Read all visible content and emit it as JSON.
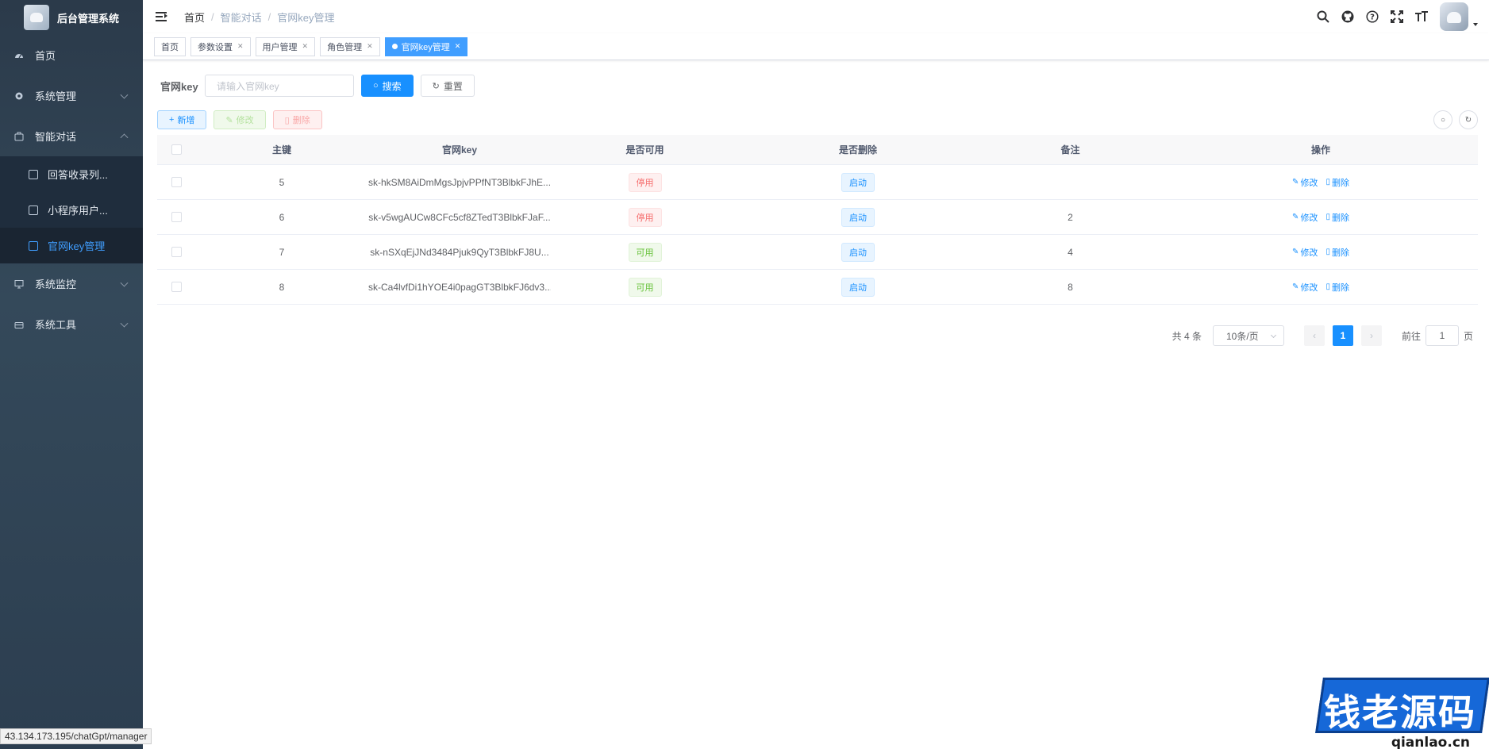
{
  "app": {
    "title": "后台管理系统"
  },
  "sidebar": {
    "items": [
      {
        "label": "首页",
        "icon": "dashboard-icon"
      },
      {
        "label": "系统管理",
        "icon": "gear-icon"
      },
      {
        "label": "智能对话",
        "icon": "briefcase-icon",
        "expanded": true,
        "children": [
          {
            "label": "回答收录列...",
            "icon": "list-icon"
          },
          {
            "label": "小程序用户...",
            "icon": "edit-icon"
          },
          {
            "label": "官网key管理",
            "icon": "checkbox-icon",
            "active": true
          }
        ]
      },
      {
        "label": "系统监控",
        "icon": "monitor-icon"
      },
      {
        "label": "系统工具",
        "icon": "toolbox-icon"
      }
    ]
  },
  "breadcrumb": [
    "首页",
    "智能对话",
    "官网key管理"
  ],
  "tags": [
    {
      "label": "首页",
      "closable": false
    },
    {
      "label": "参数设置",
      "closable": true
    },
    {
      "label": "用户管理",
      "closable": true
    },
    {
      "label": "角色管理",
      "closable": true
    },
    {
      "label": "官网key管理",
      "closable": true,
      "active": true
    }
  ],
  "search": {
    "label": "官网key",
    "placeholder": "请输入官网key",
    "search_btn": "搜索",
    "reset_btn": "重置"
  },
  "toolbar": {
    "add": "新增",
    "edit": "修改",
    "delete": "删除"
  },
  "table": {
    "columns": [
      "主键",
      "官网key",
      "是否可用",
      "是否删除",
      "备注",
      "操作"
    ],
    "rows": [
      {
        "id": "5",
        "key": "sk-hkSM8AiDmMgsJpjvPPfNT3BlbkFJhE...",
        "available": "停用",
        "available_status": "danger",
        "deleted": "启动",
        "remark": ""
      },
      {
        "id": "6",
        "key": "sk-v5wgAUCw8CFc5cf8ZTedT3BlbkFJaF...",
        "available": "停用",
        "available_status": "danger",
        "deleted": "启动",
        "remark": "2"
      },
      {
        "id": "7",
        "key": "sk-nSXqEjJNd3484Pjuk9QyT3BlbkFJ8U...",
        "available": "可用",
        "available_status": "success",
        "deleted": "启动",
        "remark": "4"
      },
      {
        "id": "8",
        "key": "sk-Ca4lvfDi1hYOE4i0pagGT3BlbkFJ6dv3...",
        "available": "可用",
        "available_status": "success",
        "deleted": "启动",
        "remark": "8"
      }
    ],
    "op_edit": "修改",
    "op_delete": "删除"
  },
  "pagination": {
    "total_text": "共 4 条",
    "page_size": "10条/页",
    "current_page": "1",
    "goto_prefix": "前往",
    "goto_value": "1",
    "goto_suffix": "页"
  },
  "status_url": "43.134.173.195/chatGpt/manager",
  "watermark": {
    "text": "钱老源码",
    "sub": "qianlao.cn"
  },
  "colors": {
    "primary": "#1890ff",
    "sidebar_bg": "#304156",
    "danger": "#f56c6c",
    "success": "#67c23a"
  }
}
